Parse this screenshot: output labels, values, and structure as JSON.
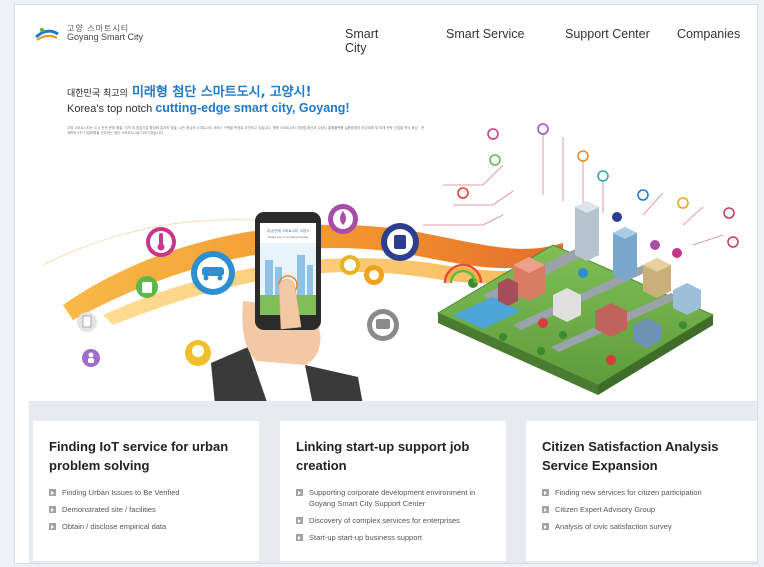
{
  "header": {
    "logo_kr": "고양 스마트시티",
    "logo_en": "Goyang Smart City",
    "nav": [
      "Smart City",
      "Smart Service",
      "Support Center",
      "Companies"
    ]
  },
  "hero": {
    "title_kr_prefix": "대한민국 최고의",
    "title_kr_highlight": "미래형 첨단 스마트도시,",
    "title_kr_city": "고양시!",
    "title_en_prefix": "Korea's top notch",
    "title_en_highlight": "cutting-edge smart city, Goyang!",
    "description": "고양 스마트시티는 도시 안전 문제 해결, 지역 내 창업기업 활성화 일자리 창출, 시민 중심의 스마트시티 서비스 구축을 목표로 추진하고 있습니다. 향후 스마트시티 리빙랩 확산과 고양시 통합플랫폼 실증환경의 조성계획 및 미래 전략 산업을 적극 육성 · 연계하여 4차 산업혁명을 선도하는 첨단 스마트도시로 나아가겠습니다."
  },
  "illustration": {
    "phone_screen_kr": "내 손안에 스마트시티 고양시",
    "phone_screen_en": "Smart city in my hand Goyang"
  },
  "cards": [
    {
      "title": "Finding IoT service for urban problem solving",
      "items": [
        "Finding Urban Issues to Be Verified",
        "Demonstrated site / facilities",
        "Obtain / disclose empirical data"
      ]
    },
    {
      "title": "Linking start-up support job creation",
      "items": [
        "Supporting corporate development environment in Goyang Smart City Support Center",
        "Discovery of complex services for enterprises",
        "Start-up start-up business support"
      ]
    },
    {
      "title": "Citizen Satisfaction Analysis Service Expansion",
      "items": [
        "Finding new services for citizen participation",
        "Citizen Expert Advisory Group",
        "Analysis of civic satisfaction survey"
      ]
    }
  ],
  "colors": {
    "accent": "#1f78c8",
    "swoosh": "#f39a1e",
    "pin": "#8e3aa5"
  }
}
